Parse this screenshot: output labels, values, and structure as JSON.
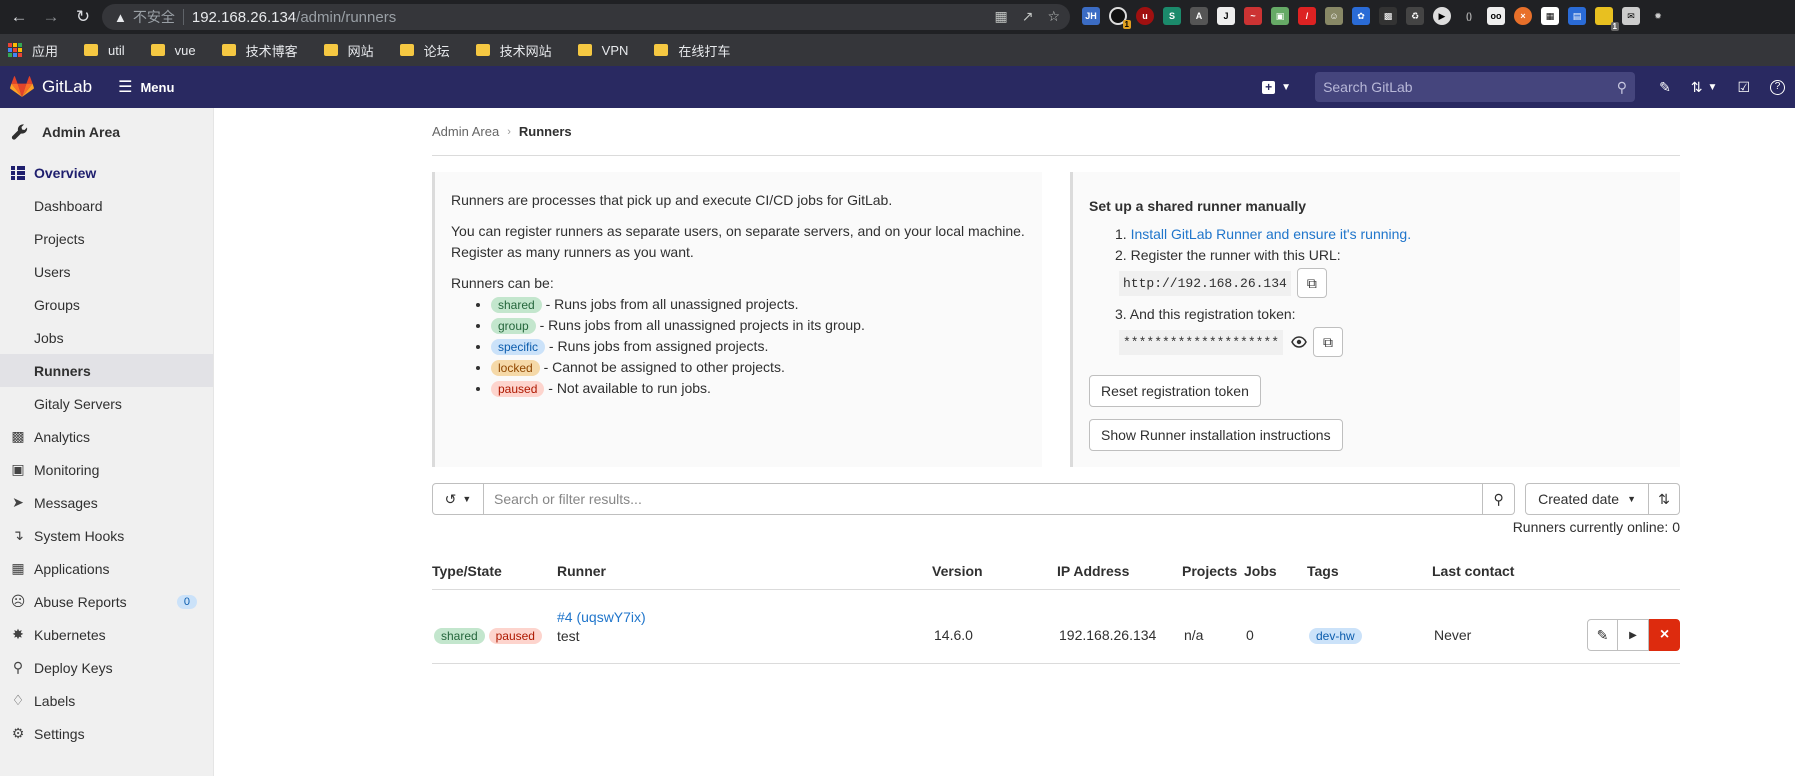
{
  "browser": {
    "insecure_label": "不安全",
    "url_host": "192.168.26.134",
    "url_path": "/admin/runners",
    "bookmarks": [
      {
        "label": "应用",
        "icon": "apps-grid-icon"
      },
      {
        "label": "util",
        "icon": "folder-icon"
      },
      {
        "label": "vue",
        "icon": "folder-icon"
      },
      {
        "label": "技术博客",
        "icon": "folder-icon"
      },
      {
        "label": "网站",
        "icon": "folder-icon"
      },
      {
        "label": "论坛",
        "icon": "folder-icon"
      },
      {
        "label": "技术网站",
        "icon": "folder-icon"
      },
      {
        "label": "VPN",
        "icon": "folder-icon"
      },
      {
        "label": "在线打车",
        "icon": "folder-icon"
      }
    ],
    "extension_badges": {
      "second": "1",
      "last": "1"
    },
    "extension_jh_label": "JH"
  },
  "header": {
    "brand": "GitLab",
    "menu_label": "Menu",
    "search_placeholder": "Search GitLab",
    "brand_color": "#292961"
  },
  "sidebar": {
    "title": "Admin Area",
    "overview_label": "Overview",
    "overview_items": [
      "Dashboard",
      "Projects",
      "Users",
      "Groups",
      "Jobs",
      "Runners",
      "Gitaly Servers"
    ],
    "selected": "Runners",
    "sections": [
      {
        "label": "Analytics",
        "icon": "chart-icon"
      },
      {
        "label": "Monitoring",
        "icon": "monitor-icon"
      },
      {
        "label": "Messages",
        "icon": "messages-icon"
      },
      {
        "label": "System Hooks",
        "icon": "hook-icon"
      },
      {
        "label": "Applications",
        "icon": "applications-icon"
      },
      {
        "label": "Abuse Reports",
        "icon": "abuse-icon",
        "badge": "0"
      },
      {
        "label": "Kubernetes",
        "icon": "kubernetes-icon"
      },
      {
        "label": "Deploy Keys",
        "icon": "key-icon"
      },
      {
        "label": "Labels",
        "icon": "label-icon"
      },
      {
        "label": "Settings",
        "icon": "settings-icon"
      }
    ]
  },
  "breadcrumb": {
    "root": "Admin Area",
    "current": "Runners"
  },
  "info": {
    "intro": "Runners are processes that pick up and execute CI/CD jobs for GitLab.",
    "register": "You can register runners as separate users, on separate servers, and on your local machine. Register as many runners as you want.",
    "can_be": "Runners can be:",
    "types": [
      {
        "badge": "shared",
        "desc": " - Runs jobs from all unassigned projects."
      },
      {
        "badge": "group",
        "desc": " - Runs jobs from all unassigned projects in its group."
      },
      {
        "badge": "specific",
        "desc": " - Runs jobs from assigned projects."
      },
      {
        "badge": "locked",
        "desc": " - Cannot be assigned to other projects."
      },
      {
        "badge": "paused",
        "desc": " - Not available to run jobs."
      }
    ]
  },
  "setup": {
    "title": "Set up a shared runner manually",
    "step1_link": "Install GitLab Runner and ensure it's running.",
    "step2": "Register the runner with this URL:",
    "url": "http://192.168.26.134",
    "step3": "And this registration token:",
    "token_masked": "********************",
    "reset_button": "Reset registration token",
    "instructions_button": "Show Runner installation instructions"
  },
  "filter": {
    "placeholder": "Search or filter results...",
    "sort_label": "Created date",
    "online_text": "Runners currently online: 0"
  },
  "table": {
    "headers": [
      "Type/State",
      "Runner",
      "Version",
      "IP Address",
      "Projects",
      "Jobs",
      "Tags",
      "Last contact"
    ],
    "rows": [
      {
        "badges": [
          "shared",
          "paused"
        ],
        "runner_id": "#4 (uqswY7ix)",
        "description": "test",
        "version": "14.6.0",
        "ip": "192.168.26.134",
        "projects": "n/a",
        "jobs": "0",
        "tags": [
          "dev-hw"
        ],
        "last_contact": "Never"
      }
    ]
  }
}
